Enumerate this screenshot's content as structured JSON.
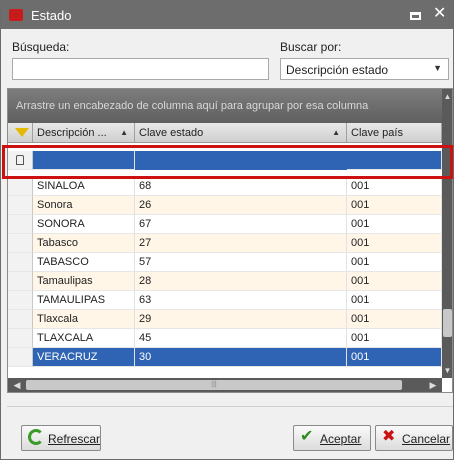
{
  "window": {
    "title": "Estado"
  },
  "search": {
    "label": "Búsqueda:",
    "value": "",
    "by_label": "Buscar por:",
    "by_selected": "Descripción estado"
  },
  "grid": {
    "group_hint": "Arrastre un encabezado de columna aquí para agrupar por esa columna",
    "columns": [
      "Descripción ...",
      "Clave estado",
      "Clave país"
    ],
    "rows": [
      {
        "desc": "SINALOA",
        "clave": "68",
        "pais": "001"
      },
      {
        "desc": "Sonora",
        "clave": "26",
        "pais": "001"
      },
      {
        "desc": "SONORA",
        "clave": "67",
        "pais": "001"
      },
      {
        "desc": "Tabasco",
        "clave": "27",
        "pais": "001"
      },
      {
        "desc": "TABASCO",
        "clave": "57",
        "pais": "001"
      },
      {
        "desc": "Tamaulipas",
        "clave": "28",
        "pais": "001"
      },
      {
        "desc": "TAMAULIPAS",
        "clave": "63",
        "pais": "001"
      },
      {
        "desc": "Tlaxcala",
        "clave": "29",
        "pais": "001"
      },
      {
        "desc": "TLAXCALA",
        "clave": "45",
        "pais": "001"
      },
      {
        "desc": "VERACRUZ",
        "clave": "30",
        "pais": "001"
      }
    ],
    "selected_row": 9
  },
  "buttons": {
    "refresh": "Refrescar",
    "accept": "Aceptar",
    "cancel": "Cancelar"
  },
  "colors": {
    "selection": "#2f63b4",
    "highlight_box": "#cc1111",
    "alt_row": "#fff6e8"
  },
  "icons": [
    "app-icon",
    "maximize-icon",
    "close-icon",
    "filter-funnel-icon",
    "sort-up-icon",
    "refresh-icon",
    "check-icon",
    "x-icon"
  ]
}
